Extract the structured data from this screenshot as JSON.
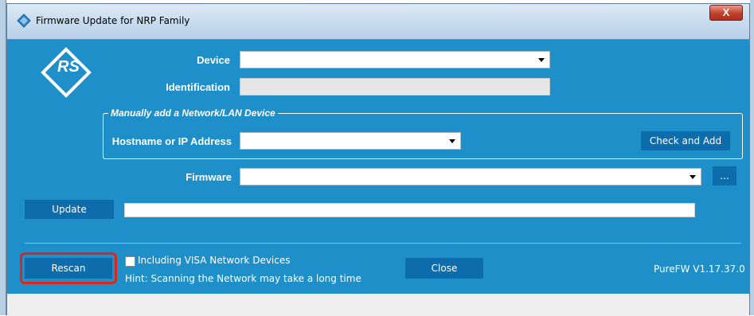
{
  "window": {
    "title": "Firmware Update for NRP Family",
    "close_label": "X"
  },
  "labels": {
    "device": "Device",
    "identification": "Identification",
    "group_title": "Manually add a Network/LAN Device",
    "hostname": "Hostname or IP Address",
    "firmware": "Firmware"
  },
  "fields": {
    "device_value": "",
    "identification_value": "",
    "hostname_value": "",
    "firmware_value": ""
  },
  "buttons": {
    "check_and_add": "Check and Add",
    "browse": "...",
    "update": "Update",
    "rescan": "Rescan",
    "close": "Close"
  },
  "footer": {
    "visa_checkbox_label": "Including VISA Network Devices",
    "hint": "Hint: Scanning the Network may take a long time",
    "version": "PureFW  V1.17.37.0"
  },
  "progress": {
    "value": 0
  },
  "logo": {
    "text": "RS"
  },
  "colors": {
    "background": "#1e8fc9",
    "button": "#0d6cab",
    "highlight": "#e0241a"
  }
}
